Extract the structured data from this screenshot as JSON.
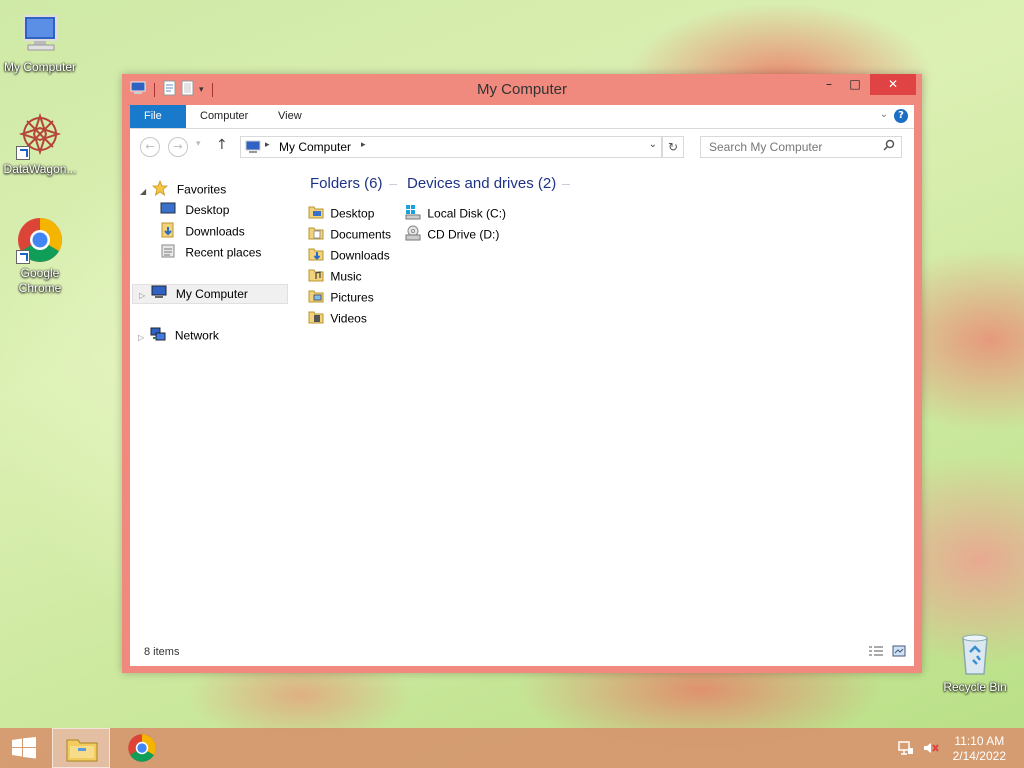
{
  "desktop": {
    "icons": [
      {
        "label": "My Computer"
      },
      {
        "label": "DataWagon..."
      },
      {
        "label": "Google Chrome"
      },
      {
        "label": "Recycle Bin"
      }
    ]
  },
  "window": {
    "title": "My Computer",
    "controls": {
      "minimize": "–",
      "maximize": "□",
      "close": "✕"
    },
    "ribbon_tabs": [
      "File",
      "Computer",
      "View"
    ],
    "help_label": "?",
    "address": {
      "path": "My Computer"
    },
    "search": {
      "placeholder": "Search My Computer"
    },
    "nav": {
      "favorites": "Favorites",
      "favorites_items": [
        "Desktop",
        "Downloads",
        "Recent places"
      ],
      "computer": "My Computer",
      "network": "Network"
    },
    "groups": {
      "folders_title": "Folders (6)",
      "folders": [
        "Desktop",
        "Documents",
        "Downloads",
        "Music",
        "Pictures",
        "Videos"
      ],
      "drives_title": "Devices and drives (2)",
      "drives": [
        "Local Disk (C:)",
        "CD Drive (D:)"
      ]
    },
    "status": "8 items"
  },
  "taskbar": {
    "time": "11:10 AM",
    "date": "2/14/2022"
  },
  "colors": {
    "window_frame": "#f08a7e",
    "close_button": "#e04343",
    "file_tab": "#1979ca",
    "group_header": "#1e3287",
    "taskbar": "#d6966e"
  }
}
